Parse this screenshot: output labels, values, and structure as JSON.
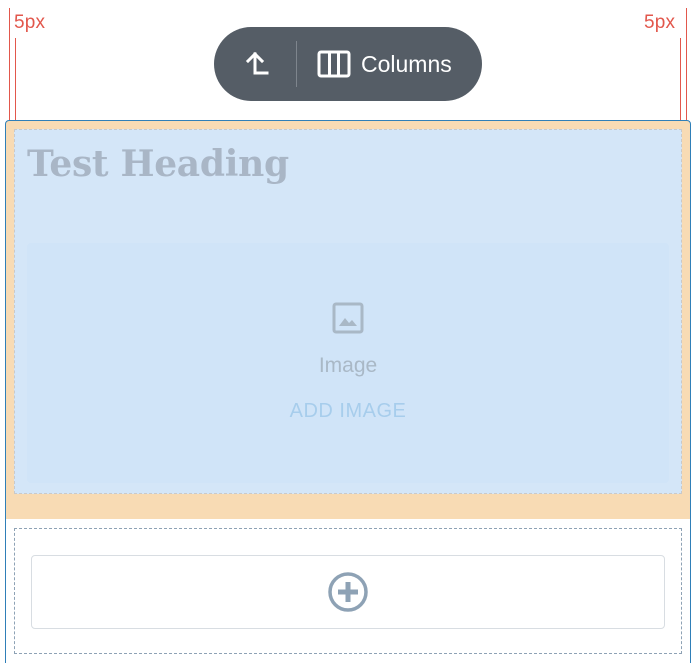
{
  "margins": {
    "left_label": "5px",
    "right_label": "5px"
  },
  "toolbar": {
    "parent_icon": "arrow-up-left-icon",
    "block_icon": "columns-icon",
    "block_label": "Columns"
  },
  "content": {
    "heading": "Test Heading",
    "image_block": {
      "icon": "image-icon",
      "label": "Image",
      "action": "ADD IMAGE"
    }
  },
  "appender": {
    "icon": "plus-circle-icon"
  },
  "colors": {
    "margin_indicator": "#e2574c",
    "toolbar_bg": "#555d66",
    "padding_fill": "#f8dbb4",
    "column_fill": "#d4e6f8",
    "selection_border": "#2f7fb8"
  }
}
